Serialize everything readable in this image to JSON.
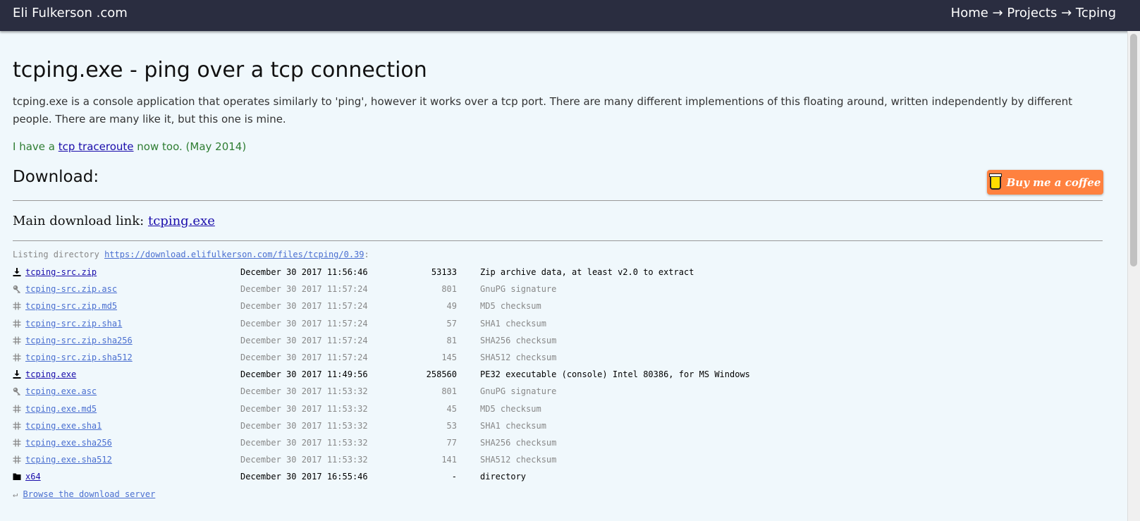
{
  "header": {
    "brand": "Eli Fulkerson .com",
    "breadcrumb": [
      "Home",
      "→",
      "Projects",
      "→",
      "Tcping"
    ]
  },
  "title": "tcping.exe - ping over a tcp connection",
  "intro": "tcping.exe is a console application that operates similarly to 'ping', however it works over a tcp port. There are many different implementions of this floating around, written independently by different people. There are many like it, but this one is mine.",
  "note": {
    "prefix": "I have a",
    "link": "tcp traceroute",
    "suffix": "now too. (May 2014)"
  },
  "download": {
    "heading": "Download:",
    "coffee_label": "Buy me a coffee",
    "main_label": "Main download link:",
    "main_link": "tcping.exe"
  },
  "listing": {
    "prefix": "Listing directory",
    "url": "https://download.elifulkerson.com/files/tcping/0.39",
    "suffix": ":",
    "rows": [
      {
        "icon": "download",
        "name": "tcping-src.zip",
        "date": "December 30 2017 11:56:46",
        "size": "53133",
        "desc": "Zip archive data, at least v2.0 to extract",
        "kind": "primary"
      },
      {
        "icon": "key",
        "name": "tcping-src.zip.asc",
        "date": "December 30 2017 11:57:24",
        "size": "801",
        "desc": "GnuPG signature",
        "kind": "secondary"
      },
      {
        "icon": "hash",
        "name": "tcping-src.zip.md5",
        "date": "December 30 2017 11:57:24",
        "size": "49",
        "desc": "MD5 checksum",
        "kind": "secondary"
      },
      {
        "icon": "hash",
        "name": "tcping-src.zip.sha1",
        "date": "December 30 2017 11:57:24",
        "size": "57",
        "desc": "SHA1 checksum",
        "kind": "secondary"
      },
      {
        "icon": "hash",
        "name": "tcping-src.zip.sha256",
        "date": "December 30 2017 11:57:24",
        "size": "81",
        "desc": "SHA256 checksum",
        "kind": "secondary"
      },
      {
        "icon": "hash",
        "name": "tcping-src.zip.sha512",
        "date": "December 30 2017 11:57:24",
        "size": "145",
        "desc": "SHA512 checksum",
        "kind": "secondary"
      },
      {
        "icon": "download",
        "name": "tcping.exe",
        "date": "December 30 2017 11:49:56",
        "size": "258560",
        "desc": "PE32 executable (console) Intel 80386, for MS Windows",
        "kind": "primary"
      },
      {
        "icon": "key",
        "name": "tcping.exe.asc",
        "date": "December 30 2017 11:53:32",
        "size": "801",
        "desc": "GnuPG signature",
        "kind": "secondary"
      },
      {
        "icon": "hash",
        "name": "tcping.exe.md5",
        "date": "December 30 2017 11:53:32",
        "size": "45",
        "desc": "MD5 checksum",
        "kind": "secondary"
      },
      {
        "icon": "hash",
        "name": "tcping.exe.sha1",
        "date": "December 30 2017 11:53:32",
        "size": "53",
        "desc": "SHA1 checksum",
        "kind": "secondary"
      },
      {
        "icon": "hash",
        "name": "tcping.exe.sha256",
        "date": "December 30 2017 11:53:32",
        "size": "77",
        "desc": "SHA256 checksum",
        "kind": "secondary"
      },
      {
        "icon": "hash",
        "name": "tcping.exe.sha512",
        "date": "December 30 2017 11:53:32",
        "size": "141",
        "desc": "SHA512 checksum",
        "kind": "secondary"
      },
      {
        "icon": "folder",
        "name": "x64",
        "date": "December 30 2017 16:55:46",
        "size": "-",
        "desc": "directory",
        "kind": "primary"
      }
    ],
    "browse_arrow": "↵",
    "browse_label": "Browse the download server"
  },
  "colors": {
    "topbar": "#2a2d40",
    "background": "#f0f8fc",
    "link": "#1a0dab",
    "muted_link": "#4a6fd0",
    "note": "#2e7d32",
    "coffee": "#ff813f"
  }
}
